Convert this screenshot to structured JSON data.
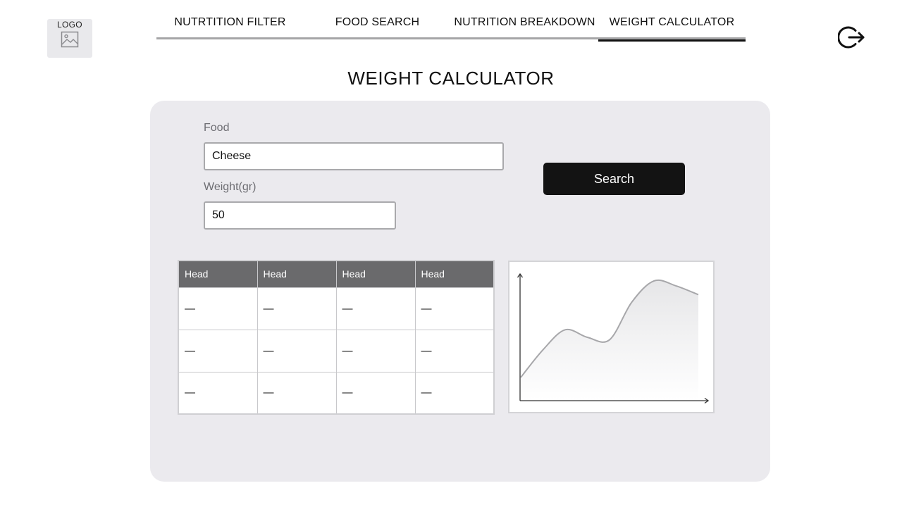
{
  "logo": {
    "text": "LOGO",
    "icon": "image-icon"
  },
  "nav": {
    "tabs": [
      {
        "label": "NUTRTITION FILTER",
        "active": false
      },
      {
        "label": "FOOD SEARCH",
        "active": false
      },
      {
        "label": "NUTRITION BREAKDOWN",
        "active": false
      },
      {
        "label": "WEIGHT CALCULATOR",
        "active": true
      }
    ]
  },
  "header": {
    "logout_icon": "logout-icon"
  },
  "page": {
    "title": "WEIGHT CALCULATOR"
  },
  "form": {
    "food_label": "Food",
    "food_value": "Cheese",
    "weight_label": "Weight(gr)",
    "weight_value": "50",
    "search_label": "Search"
  },
  "table": {
    "headers": [
      "Head",
      "Head",
      "Head",
      "Head"
    ],
    "rows": [
      [
        "—",
        "—",
        "—",
        "—"
      ],
      [
        "—",
        "—",
        "—",
        "—"
      ],
      [
        "—",
        "—",
        "—",
        "—"
      ]
    ]
  },
  "chart_data": {
    "type": "area",
    "x": [
      0,
      1,
      2,
      3,
      4,
      5,
      6,
      7,
      8
    ],
    "values": [
      18,
      40,
      56,
      50,
      48,
      78,
      95,
      91,
      84
    ],
    "ylim": [
      0,
      100
    ],
    "title": "",
    "xlabel": "",
    "ylabel": "",
    "grid": false,
    "line_color": "#a7a7aa"
  },
  "colors": {
    "panel": "#ebeaee",
    "button": "#131313",
    "table_header": "#6a6a6c",
    "nav_underline": "#a5a5a7",
    "active_underline": "#111111"
  }
}
